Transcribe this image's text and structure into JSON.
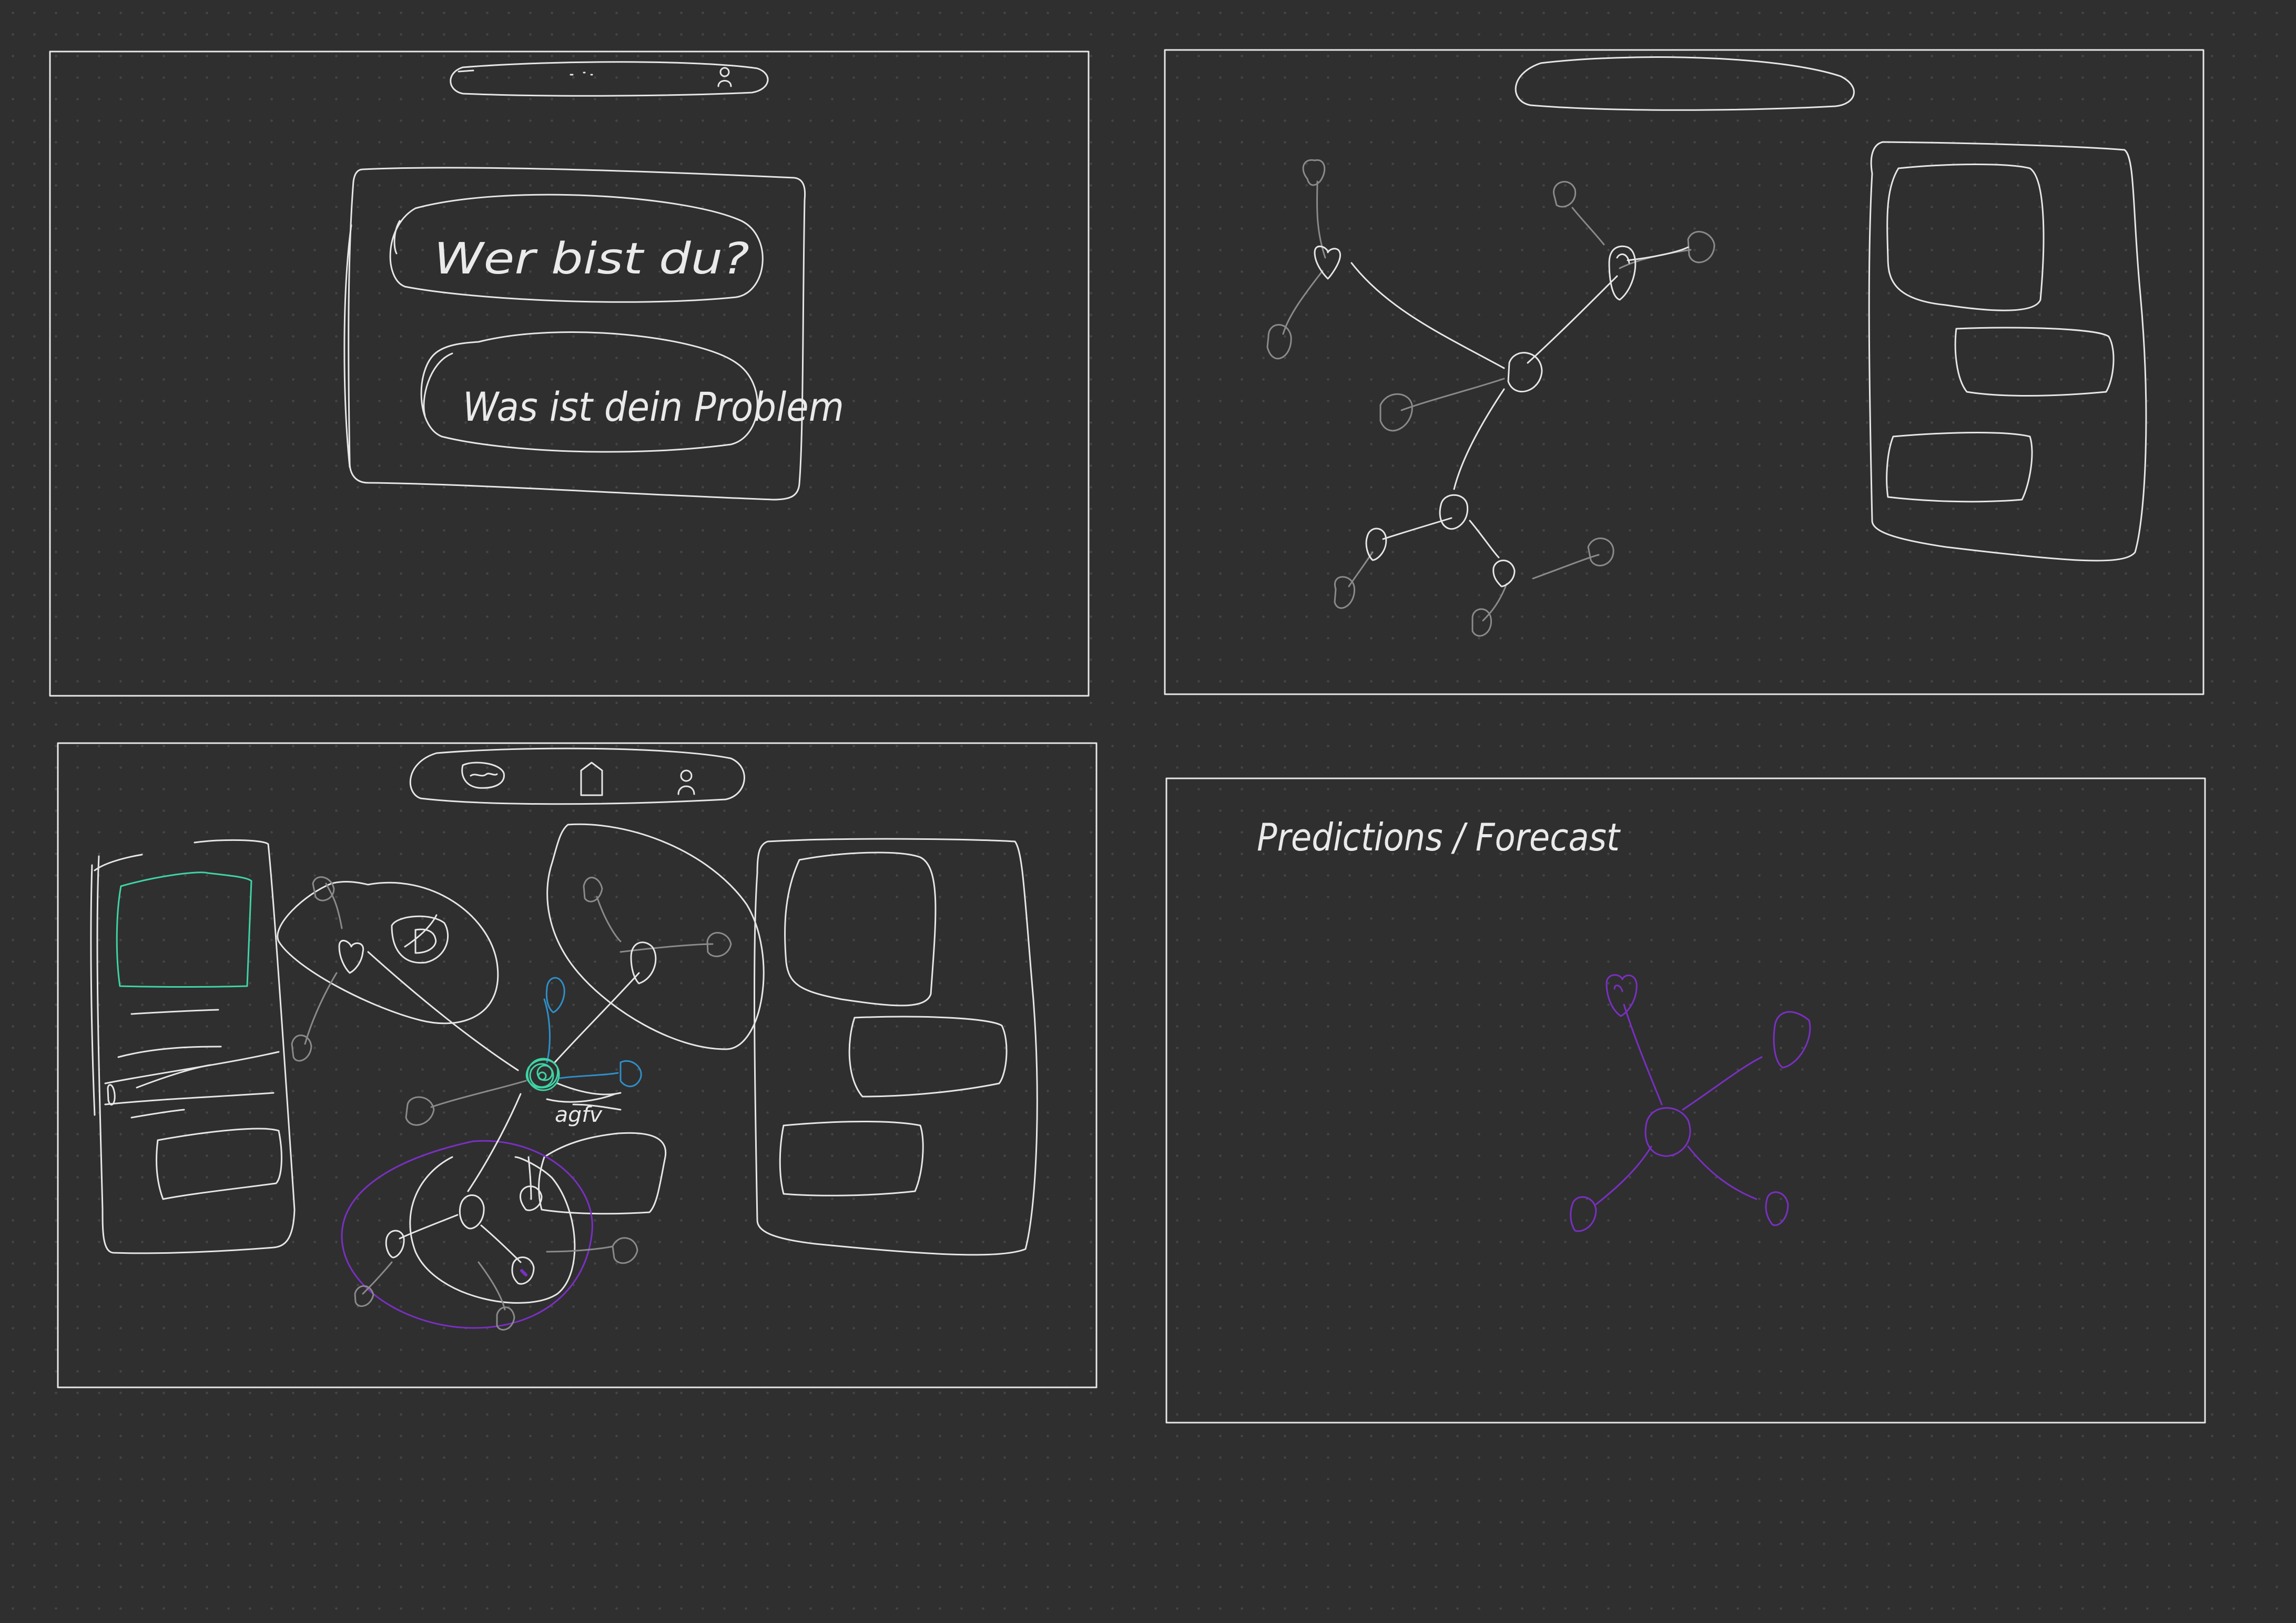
{
  "colors": {
    "background": "#2f2f2f",
    "dot_grid": "#454545",
    "stroke_primary": "#e6e6e6",
    "stroke_faint": "#8a8a8a",
    "accent_teal": "#3fd3a6",
    "accent_blue": "#2f8fc9",
    "accent_purple": "#7a2fc4"
  },
  "frame1": {
    "question_1": "Wer bist du?",
    "question_2": "Was ist dein Problem"
  },
  "frame3": {
    "node_annotation": "agfv"
  },
  "frame4": {
    "title": "Predictions / Forecast"
  }
}
